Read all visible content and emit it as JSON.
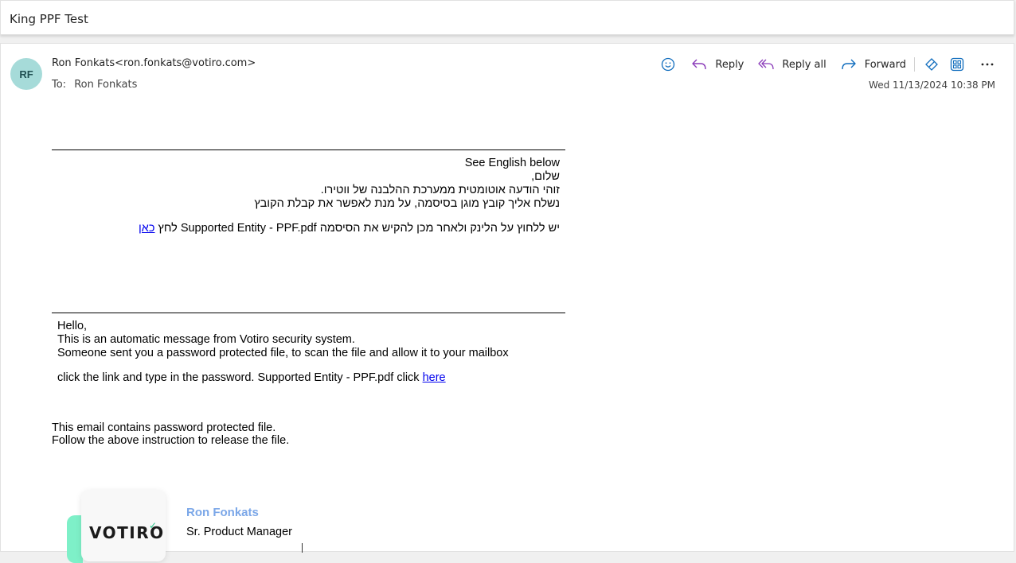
{
  "subject": "King PPF Test",
  "sender": {
    "initials": "RF",
    "from_line": "Ron Fonkats<ron.fonkats@votiro.com>",
    "to_label": "To:",
    "to_value": "Ron Fonkats"
  },
  "actions": {
    "reply": "Reply",
    "reply_all": "Reply all",
    "forward": "Forward",
    "date": "Wed 11/13/2024 10:38 PM"
  },
  "hebrew": {
    "see_english": "See English below",
    "greeting": "שלום,",
    "line1": "זוהי הודעה אוטומטית ממערכת ההלבנה של ווטירו.",
    "line2": "נשלח אליך קובץ מוגן בסיסמה, על מנת לאפשר את קבלת הקובץ",
    "instruction": "יש ללחוץ על הלינק ולאחר מכן להקיש את הסיסמה Supported Entity - PPF.pdf לחץ",
    "link": "כאן"
  },
  "english": {
    "greeting": "Hello,",
    "line1": "This is an automatic message from Votiro security system.",
    "line2": "Someone sent you a password protected file, to scan the file and allow it to your mailbox",
    "instruction": "click the link and type in the password. Supported Entity - PPF.pdf click",
    "link": "here"
  },
  "footer": {
    "line1": "This email contains password protected file.",
    "line2": "Follow the above instruction to release the file."
  },
  "signature": {
    "logo": "VOTIRO",
    "name": "Ron Fonkats",
    "title": "Sr. Product Manager"
  },
  "colors": {
    "avatar_bg": "#a6dbd9",
    "accent_blue": "#0f6cbd",
    "reply_all_purple": "#8a3ab9",
    "link": "#0000ee",
    "signature_name": "#7ba7e8",
    "logo_accent": "#7ef0c8"
  },
  "icons": [
    "emoji-icon",
    "reply-icon",
    "reply-all-icon",
    "forward-icon",
    "immersive-reader-icon",
    "apps-icon",
    "more-icon"
  ]
}
